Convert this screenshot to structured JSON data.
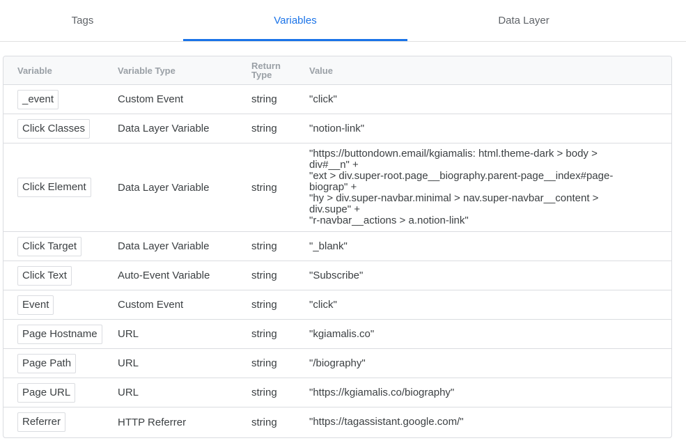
{
  "tabs": [
    {
      "label": "Tags",
      "active": false
    },
    {
      "label": "Variables",
      "active": true
    },
    {
      "label": "Data Layer",
      "active": false
    }
  ],
  "table": {
    "headers": {
      "variable": "Variable",
      "type": "Variable Type",
      "return_type_1": "Return",
      "return_type_2": "Type",
      "value": "Value"
    },
    "rows": [
      {
        "name": "_event",
        "type": "Custom Event",
        "return_type": "string",
        "value": [
          "\"click\""
        ]
      },
      {
        "name": "Click Classes",
        "type": "Data Layer Variable",
        "return_type": "string",
        "value": [
          "\"notion-link\""
        ]
      },
      {
        "name": "Click Element",
        "type": "Data Layer Variable",
        "return_type": "string",
        "value": [
          "\"https://buttondown.email/kgiamalis: html.theme-dark > body >",
          "div#__n\" +",
          "\"ext > div.super-root.page__biography.parent-page__index#page-",
          "biograp\" +",
          "\"hy > div.super-navbar.minimal > nav.super-navbar__content >",
          "div.supe\" +",
          "\"r-navbar__actions > a.notion-link\""
        ]
      },
      {
        "name": "Click Target",
        "type": "Data Layer Variable",
        "return_type": "string",
        "value": [
          "\"_blank\""
        ]
      },
      {
        "name": "Click Text",
        "type": "Auto-Event Variable",
        "return_type": "string",
        "value": [
          "\"Subscribe\""
        ]
      },
      {
        "name": "Event",
        "type": "Custom Event",
        "return_type": "string",
        "value": [
          "\"click\""
        ]
      },
      {
        "name": "Page Hostname",
        "type": "URL",
        "return_type": "string",
        "value": [
          "\"kgiamalis.co\""
        ]
      },
      {
        "name": "Page Path",
        "type": "URL",
        "return_type": "string",
        "value": [
          "\"/biography\""
        ]
      },
      {
        "name": "Page URL",
        "type": "URL",
        "return_type": "string",
        "value": [
          "\"https://kgiamalis.co/biography\""
        ]
      },
      {
        "name": "Referrer",
        "type": "HTTP Referrer",
        "return_type": "string",
        "value": [
          "\"https://tagassistant.google.com/\""
        ]
      }
    ]
  },
  "colors": {
    "accent": "#1a73e8",
    "border": "#dadce0",
    "header_bg": "#f8f9fa"
  }
}
